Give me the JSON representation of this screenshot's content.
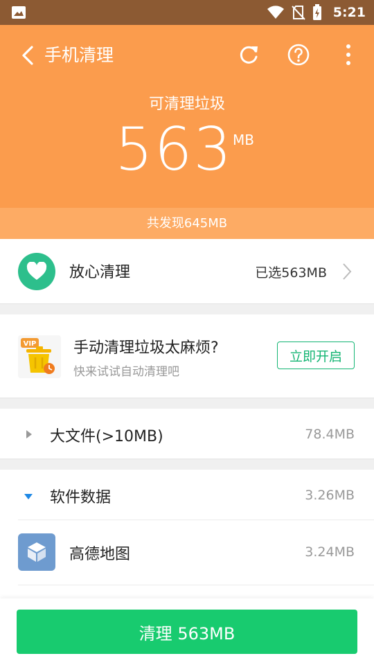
{
  "status_bar": {
    "time": "5:21"
  },
  "header": {
    "title": "手机清理",
    "subtitle": "可清理垃圾",
    "amount": "563",
    "unit": "MB",
    "found_text": "共发现645MB"
  },
  "safe_clean": {
    "label": "放心清理",
    "selected": "已选563MB"
  },
  "vip_promo": {
    "badge": "VIP",
    "title": "手动清理垃圾太麻烦?",
    "subtitle": "快来试试自动清理吧",
    "button": "立即开启"
  },
  "categories": [
    {
      "label": "大文件(>10MB)",
      "size": "78.4MB",
      "expanded": false
    },
    {
      "label": "软件数据",
      "size": "3.26MB",
      "expanded": true,
      "items": [
        {
          "name": "高德地图",
          "size": "3.24MB"
        }
      ]
    }
  ],
  "bottom": {
    "clean_button": "清理 563MB"
  },
  "colors": {
    "header_bg": "#fb9c4d",
    "accent_green": "#18cb6f",
    "safe_icon": "#2dbf8c",
    "expand_blue": "#1e88e5"
  }
}
